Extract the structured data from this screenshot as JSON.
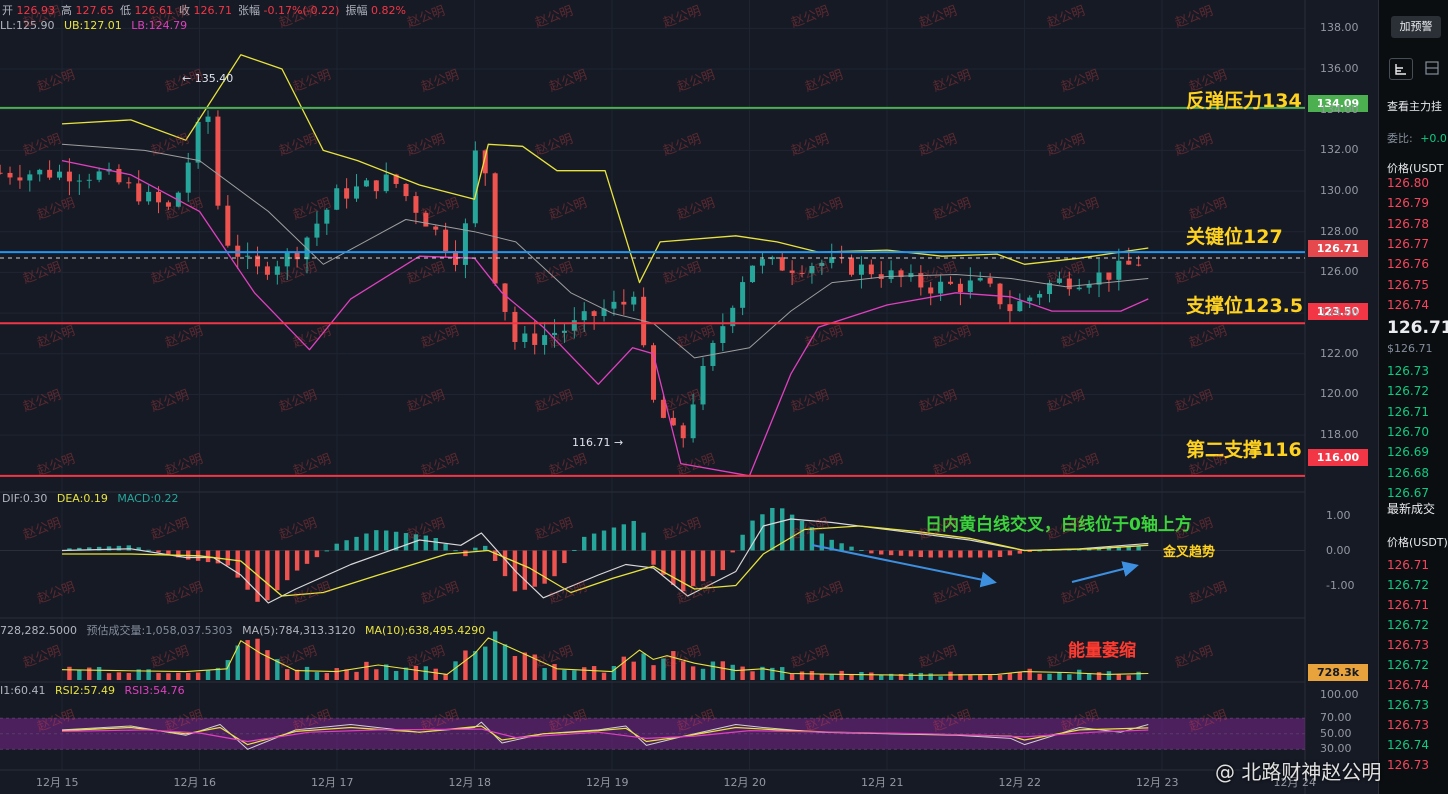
{
  "ohlc": [
    {
      "label": "开",
      "value": "126.93"
    },
    {
      "label": "高",
      "value": "127.65"
    },
    {
      "label": "低",
      "value": "126.61"
    },
    {
      "label": "收",
      "value": "126.71"
    },
    {
      "label": "张幅",
      "value": "-0.17%(-0.22)"
    },
    {
      "label": "振幅",
      "value": "0.82%"
    }
  ],
  "bb": {
    "ll": "LL:125.90",
    "ub": "UB:127.01",
    "lb": "LB:124.79"
  },
  "macd_label": {
    "dif": "DIF:0.30",
    "dea": "DEA:0.19",
    "macd": "MACD:0.22"
  },
  "vol_label": {
    "vol": "728,282.5000",
    "pred": "预估成交量:1,058,037.5303",
    "ma5": "MA(5):784,313.3120",
    "ma10": "MA(10):638,495.4290"
  },
  "rsi_label": {
    "r1": "I1:60.41",
    "r2": "RSI2:57.49",
    "r3": "RSI3:54.76"
  },
  "annotations": {
    "resistance": "反弹压力134",
    "key": "关键位127",
    "support": "支撑位123.5",
    "support2": "第二支撑116",
    "macd_note": "日内黄白线交叉，白线位于0轴上方",
    "golden": "金叉趋势",
    "volume_note": "能量萎缩"
  },
  "tags": {
    "resistance": "134.09",
    "current": "126.71",
    "support": "123.50",
    "support2": "116.00",
    "volume": "728.3k"
  },
  "extremes": {
    "high": "← 135.40",
    "low": "116.71 →"
  },
  "price_axis": [
    "138.00",
    "136.00",
    "134.00",
    "132.00",
    "130.00",
    "128.00",
    "126.00",
    "124.00",
    "122.00",
    "120.00",
    "118.00"
  ],
  "macd_axis": [
    "1.00",
    "0.00",
    "-1.00"
  ],
  "rsi_axis": [
    "100.00",
    "70.00",
    "50.00",
    "30.00"
  ],
  "date_axis": [
    "12月 15",
    "12月 16",
    "12月 17",
    "12月 18",
    "12月 19",
    "12月 20",
    "12月 21",
    "12月 22",
    "12月 23",
    "12月 24"
  ],
  "watermark": "赵公明",
  "credit": "@ 北路财神赵公明",
  "side": {
    "btn": "加预警",
    "main": "查看主力挂",
    "ratio_label": "委比:",
    "ratio_val": "+0.0",
    "header1": "价格(USDT",
    "asks": [
      "126.80",
      "126.79",
      "126.78",
      "126.77",
      "126.76",
      "126.75",
      "126.74"
    ],
    "big": "126.71",
    "big_sub": "$126.71",
    "bids": [
      "126.73",
      "126.72",
      "126.71",
      "126.70",
      "126.69",
      "126.68",
      "126.67"
    ],
    "trades_title": "最新成交",
    "header2": "价格(USDT)",
    "trades": [
      "126.71",
      "126.72",
      "126.71",
      "126.72",
      "126.73",
      "126.72",
      "126.74",
      "126.73",
      "126.73",
      "126.74",
      "126.73"
    ]
  },
  "colors": {
    "up": "#26a69a",
    "down": "#ef5350",
    "resistance": "#4caf50",
    "key": "#2196f3",
    "support": "#f23645",
    "bb_upper": "#e8e33c",
    "bb_lower": "#e040c0",
    "bb_mid": "#9e9e9e",
    "macd_dif": "#d8d8d8",
    "macd_dea": "#e8e33c",
    "annot_yellow": "#ffd21f",
    "annot_green": "#3bd43b",
    "annot_red": "#ff3b30"
  },
  "chart_data": {
    "type": "candlestick",
    "x": [
      "12月 15",
      "12月 16",
      "12月 17",
      "12月 18",
      "12月 19",
      "12月 20",
      "12月 21",
      "12月 22",
      "12月 23"
    ],
    "ylim": [
      115.5,
      139
    ],
    "close_path": [
      [
        0,
        130.9
      ],
      [
        0.3,
        130.8
      ],
      [
        0.8,
        129
      ],
      [
        1.0,
        133.2
      ],
      [
        1.08,
        133.8
      ],
      [
        1.15,
        128
      ],
      [
        1.4,
        126
      ],
      [
        1.7,
        127
      ],
      [
        2.0,
        129.8
      ],
      [
        2.4,
        130.6
      ],
      [
        2.9,
        126.5
      ],
      [
        3.05,
        134
      ],
      [
        3.12,
        126.5
      ],
      [
        3.3,
        122.5
      ],
      [
        3.7,
        123.3
      ],
      [
        3.95,
        124.2
      ],
      [
        4.1,
        124.5
      ],
      [
        4.12,
        127.2
      ],
      [
        4.2,
        123
      ],
      [
        4.3,
        119.6
      ],
      [
        4.5,
        117.5
      ],
      [
        4.6,
        120
      ],
      [
        4.9,
        125
      ],
      [
        5.0,
        126.5
      ],
      [
        5.3,
        126.3
      ],
      [
        5.5,
        126.5
      ],
      [
        5.9,
        126.1
      ],
      [
        6.3,
        125.3
      ],
      [
        6.7,
        125.4
      ],
      [
        6.9,
        124.2
      ],
      [
        7.2,
        125.5
      ],
      [
        7.6,
        125.9
      ],
      [
        7.9,
        126.7
      ]
    ],
    "bb_upper": [
      [
        0,
        133.3
      ],
      [
        0.5,
        133.5
      ],
      [
        0.9,
        132.5
      ],
      [
        1.3,
        136.7
      ],
      [
        1.6,
        136
      ],
      [
        1.9,
        132
      ],
      [
        2.15,
        131.5
      ],
      [
        2.6,
        130.3
      ],
      [
        3.0,
        129.6
      ],
      [
        3.1,
        132.3
      ],
      [
        3.35,
        132.2
      ],
      [
        3.6,
        131
      ],
      [
        3.95,
        131
      ],
      [
        4.2,
        125.5
      ],
      [
        4.35,
        127.5
      ],
      [
        4.9,
        127.8
      ],
      [
        5.2,
        127.5
      ],
      [
        5.5,
        127
      ],
      [
        6.0,
        127.1
      ],
      [
        6.4,
        126.8
      ],
      [
        6.8,
        126.9
      ],
      [
        7.0,
        126.4
      ],
      [
        7.4,
        126.7
      ],
      [
        7.9,
        127.2
      ]
    ],
    "bb_lower": [
      [
        0,
        131.5
      ],
      [
        0.5,
        130.8
      ],
      [
        1.0,
        129
      ],
      [
        1.4,
        125
      ],
      [
        1.8,
        122.2
      ],
      [
        2.1,
        124.7
      ],
      [
        2.6,
        126.8
      ],
      [
        3.0,
        126.7
      ],
      [
        3.2,
        125
      ],
      [
        3.5,
        123.3
      ],
      [
        3.9,
        120.5
      ],
      [
        4.15,
        122.3
      ],
      [
        4.3,
        122
      ],
      [
        4.5,
        116.6
      ],
      [
        5.0,
        116
      ],
      [
        5.3,
        121
      ],
      [
        5.5,
        123.3
      ],
      [
        6.0,
        124.4
      ],
      [
        6.5,
        125
      ],
      [
        6.9,
        124.8
      ],
      [
        7.2,
        124.1
      ],
      [
        7.7,
        124.1
      ],
      [
        7.9,
        124.7
      ]
    ],
    "bb_mid": [
      [
        0,
        132.3
      ],
      [
        0.6,
        132
      ],
      [
        1.0,
        131.5
      ],
      [
        1.5,
        129
      ],
      [
        1.9,
        126.4
      ],
      [
        2.5,
        128.6
      ],
      [
        3.0,
        128
      ],
      [
        3.3,
        127.5
      ],
      [
        3.7,
        125
      ],
      [
        4.0,
        124
      ],
      [
        4.3,
        123.5
      ],
      [
        4.6,
        121.8
      ],
      [
        5.0,
        122.3
      ],
      [
        5.3,
        124.1
      ],
      [
        5.6,
        125.5
      ],
      [
        6.0,
        125.8
      ],
      [
        6.5,
        125.9
      ],
      [
        6.9,
        125.7
      ],
      [
        7.3,
        125.3
      ],
      [
        7.9,
        125.7
      ]
    ],
    "macd_ylim": [
      -1.7,
      1.3
    ],
    "macd_dif": [
      [
        0,
        0
      ],
      [
        0.5,
        0.05
      ],
      [
        0.9,
        -0.2
      ],
      [
        1.1,
        -0.2
      ],
      [
        1.3,
        -0.7
      ],
      [
        1.5,
        -1.5
      ],
      [
        1.7,
        -1.1
      ],
      [
        2.1,
        -0.4
      ],
      [
        2.6,
        0.3
      ],
      [
        2.9,
        0.15
      ],
      [
        3.05,
        0.5
      ],
      [
        3.3,
        -0.6
      ],
      [
        3.5,
        -1.35
      ],
      [
        3.9,
        -0.7
      ],
      [
        4.1,
        -0.4
      ],
      [
        4.3,
        -0.5
      ],
      [
        4.55,
        -1.3
      ],
      [
        4.9,
        -0.6
      ],
      [
        5.1,
        0.7
      ],
      [
        5.3,
        0.9
      ],
      [
        5.6,
        0.8
      ],
      [
        6.1,
        0.55
      ],
      [
        6.6,
        0.3
      ],
      [
        7.0,
        0
      ],
      [
        7.4,
        0.05
      ],
      [
        7.9,
        0.2
      ]
    ],
    "macd_dea": [
      [
        0,
        -0.1
      ],
      [
        0.5,
        -0.1
      ],
      [
        1.0,
        -0.15
      ],
      [
        1.3,
        -0.3
      ],
      [
        1.6,
        -1.3
      ],
      [
        1.9,
        -1.2
      ],
      [
        2.3,
        -0.7
      ],
      [
        2.8,
        -0.1
      ],
      [
        3.1,
        0
      ],
      [
        3.4,
        -0.5
      ],
      [
        3.7,
        -1.2
      ],
      [
        4.0,
        -0.8
      ],
      [
        4.3,
        -0.45
      ],
      [
        4.6,
        -1.1
      ],
      [
        4.9,
        -1.0
      ],
      [
        5.1,
        -0.1
      ],
      [
        5.4,
        0.6
      ],
      [
        5.8,
        0.7
      ],
      [
        6.2,
        0.55
      ],
      [
        6.6,
        0.35
      ],
      [
        7.0,
        0
      ],
      [
        7.5,
        0.05
      ],
      [
        7.9,
        0.15
      ]
    ],
    "macd_hist": [
      [
        0,
        0.05
      ],
      [
        0.5,
        0.15
      ],
      [
        0.9,
        -0.25
      ],
      [
        1.2,
        -0.4
      ],
      [
        1.45,
        -1.6
      ],
      [
        1.7,
        -0.6
      ],
      [
        2.0,
        0.2
      ],
      [
        2.3,
        0.6
      ],
      [
        2.7,
        0.4
      ],
      [
        2.95,
        -0.2
      ],
      [
        3.05,
        0.3
      ],
      [
        3.3,
        -1.2
      ],
      [
        3.55,
        -0.9
      ],
      [
        3.8,
        0.4
      ],
      [
        4.05,
        0.7
      ],
      [
        4.2,
        0.9
      ],
      [
        4.3,
        -0.4
      ],
      [
        4.5,
        -1.2
      ],
      [
        4.8,
        -0.6
      ],
      [
        5.0,
        0.8
      ],
      [
        5.2,
        1.3
      ],
      [
        5.4,
        0.8
      ],
      [
        5.6,
        0.3
      ],
      [
        5.9,
        -0.1
      ],
      [
        6.3,
        -0.2
      ],
      [
        6.8,
        -0.2
      ],
      [
        7.1,
        0
      ],
      [
        7.5,
        0.08
      ],
      [
        7.9,
        0.12
      ]
    ],
    "volume": [
      [
        0,
        1.1
      ],
      [
        0.4,
        1.0
      ],
      [
        0.9,
        0.9
      ],
      [
        1.2,
        1.2
      ],
      [
        1.3,
        4.2
      ],
      [
        1.45,
        2.8
      ],
      [
        1.7,
        1.0
      ],
      [
        2.0,
        0.9
      ],
      [
        2.3,
        1.6
      ],
      [
        2.8,
        0.6
      ],
      [
        3.0,
        2.8
      ],
      [
        3.1,
        4.5
      ],
      [
        3.3,
        3.2
      ],
      [
        3.6,
        1.2
      ],
      [
        4.0,
        0.9
      ],
      [
        4.2,
        3.2
      ],
      [
        4.3,
        2.2
      ],
      [
        4.4,
        2.6
      ],
      [
        4.6,
        1.8
      ],
      [
        4.9,
        1.0
      ],
      [
        5.1,
        1.2
      ],
      [
        5.3,
        0.7
      ],
      [
        5.7,
        0.6
      ],
      [
        6.2,
        0.5
      ],
      [
        6.8,
        0.6
      ],
      [
        7.0,
        0.9
      ],
      [
        7.3,
        0.8
      ],
      [
        7.6,
        0.6
      ],
      [
        7.9,
        0.7
      ]
    ],
    "rsi_ylim": [
      20,
      100
    ],
    "rsi1": [
      [
        0,
        55
      ],
      [
        0.5,
        60
      ],
      [
        0.9,
        48
      ],
      [
        1.15,
        62
      ],
      [
        1.35,
        30
      ],
      [
        1.7,
        55
      ],
      [
        2.1,
        62
      ],
      [
        2.6,
        52
      ],
      [
        3.0,
        58
      ],
      [
        3.05,
        65
      ],
      [
        3.2,
        38
      ],
      [
        3.5,
        50
      ],
      [
        3.9,
        55
      ],
      [
        4.1,
        60
      ],
      [
        4.25,
        35
      ],
      [
        4.5,
        46
      ],
      [
        4.9,
        62
      ],
      [
        5.1,
        58
      ],
      [
        5.5,
        52
      ],
      [
        6.0,
        50
      ],
      [
        6.5,
        48
      ],
      [
        6.9,
        44
      ],
      [
        7.0,
        36
      ],
      [
        7.4,
        58
      ],
      [
        7.7,
        52
      ],
      [
        7.9,
        62
      ]
    ],
    "rsi2": [
      [
        0,
        54
      ],
      [
        0.5,
        58
      ],
      [
        0.9,
        50
      ],
      [
        1.15,
        58
      ],
      [
        1.35,
        36
      ],
      [
        1.7,
        53
      ],
      [
        2.1,
        58
      ],
      [
        2.6,
        52
      ],
      [
        3.05,
        60
      ],
      [
        3.2,
        42
      ],
      [
        3.5,
        50
      ],
      [
        3.9,
        54
      ],
      [
        4.1,
        57
      ],
      [
        4.25,
        40
      ],
      [
        4.5,
        46
      ],
      [
        4.9,
        58
      ],
      [
        5.2,
        55
      ],
      [
        5.6,
        52
      ],
      [
        6.2,
        50
      ],
      [
        6.9,
        47
      ],
      [
        7.0,
        42
      ],
      [
        7.4,
        55
      ],
      [
        7.9,
        57.5
      ]
    ],
    "rsi3": [
      [
        0,
        53
      ],
      [
        0.6,
        55
      ],
      [
        1.0,
        51
      ],
      [
        1.35,
        40
      ],
      [
        1.8,
        52
      ],
      [
        2.3,
        55
      ],
      [
        3.05,
        56
      ],
      [
        3.3,
        45
      ],
      [
        3.9,
        52
      ],
      [
        4.25,
        44
      ],
      [
        4.6,
        47
      ],
      [
        5.0,
        54
      ],
      [
        5.6,
        52
      ],
      [
        6.3,
        50
      ],
      [
        7.0,
        46
      ],
      [
        7.5,
        52
      ],
      [
        7.9,
        54.8
      ]
    ]
  }
}
